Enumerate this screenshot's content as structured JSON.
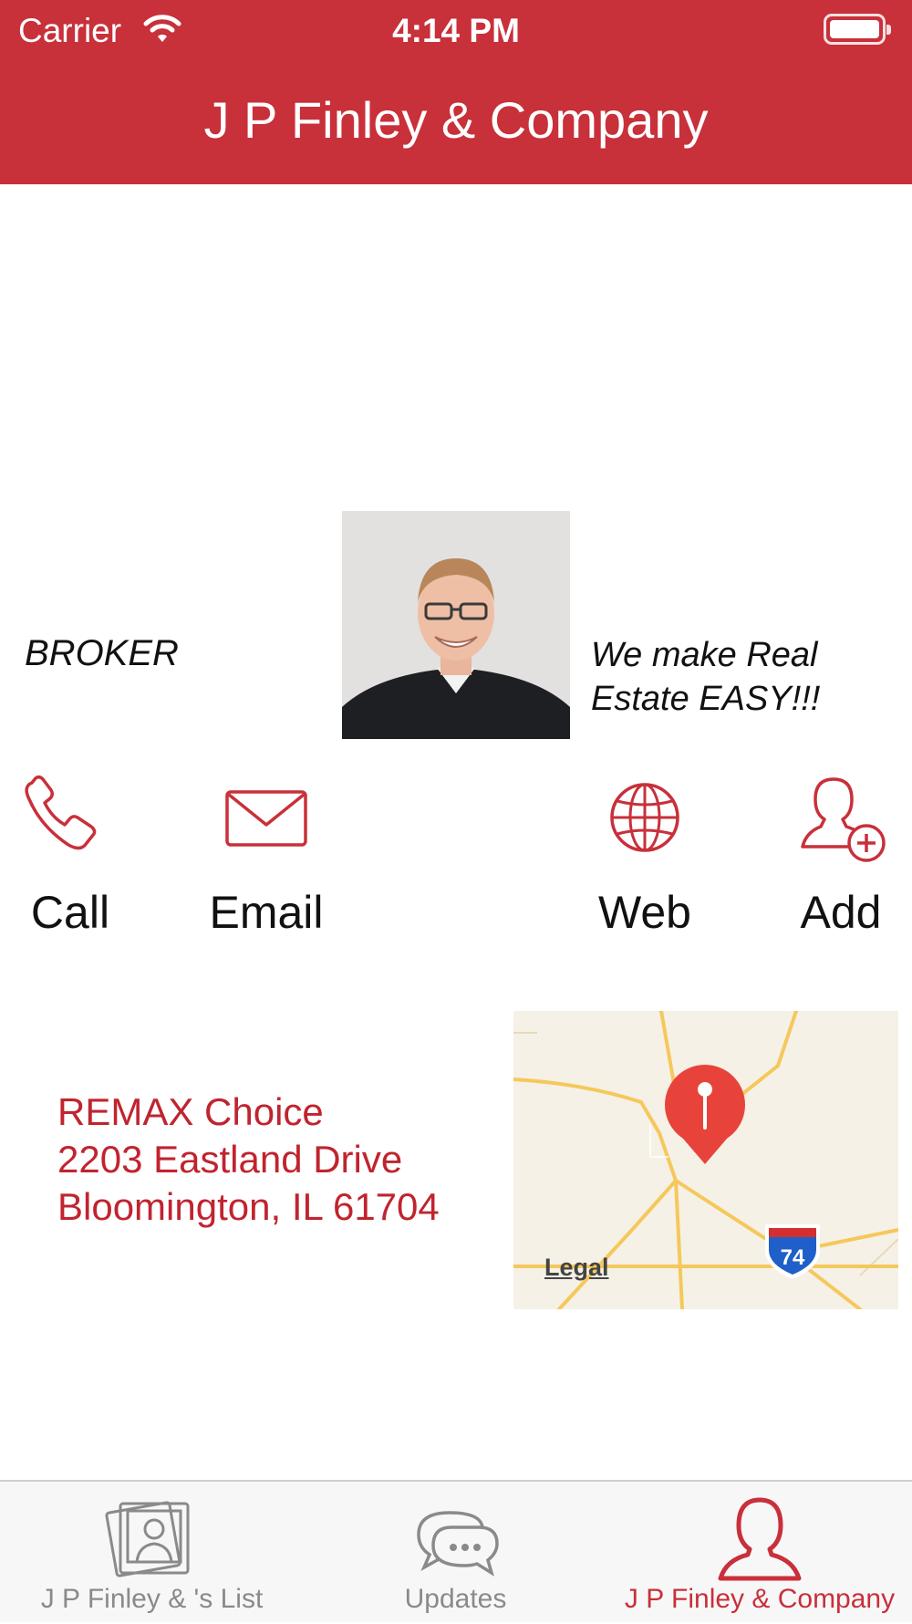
{
  "status_bar": {
    "carrier": "Carrier",
    "time": "4:14 PM"
  },
  "header": {
    "title": "J P Finley &  Company"
  },
  "profile": {
    "role": "BROKER",
    "tagline_line1": "We make Real",
    "tagline_line2": "Estate EASY!!!"
  },
  "actions": [
    {
      "label": "Call",
      "icon": "phone-icon"
    },
    {
      "label": "Email",
      "icon": "envelope-icon"
    },
    {
      "label": "Web",
      "icon": "globe-icon"
    },
    {
      "label": "Add",
      "icon": "add-contact-icon"
    }
  ],
  "address": {
    "line1": "REMAX Choice",
    "line2": "2203 Eastland Drive",
    "line3": "Bloomington, IL 61704"
  },
  "map": {
    "legal": "Legal",
    "highway_shield": "74"
  },
  "tabs": [
    {
      "label": "J P Finley & 's List",
      "icon": "photos-icon",
      "active": false
    },
    {
      "label": "Updates",
      "icon": "chat-bubble-icon",
      "active": false
    },
    {
      "label": "J P Finley &  Company",
      "icon": "person-icon",
      "active": true
    }
  ],
  "colors": {
    "brand": "#c8303a",
    "address_text": "#c0242f",
    "tab_inactive": "#8a8a8a"
  }
}
